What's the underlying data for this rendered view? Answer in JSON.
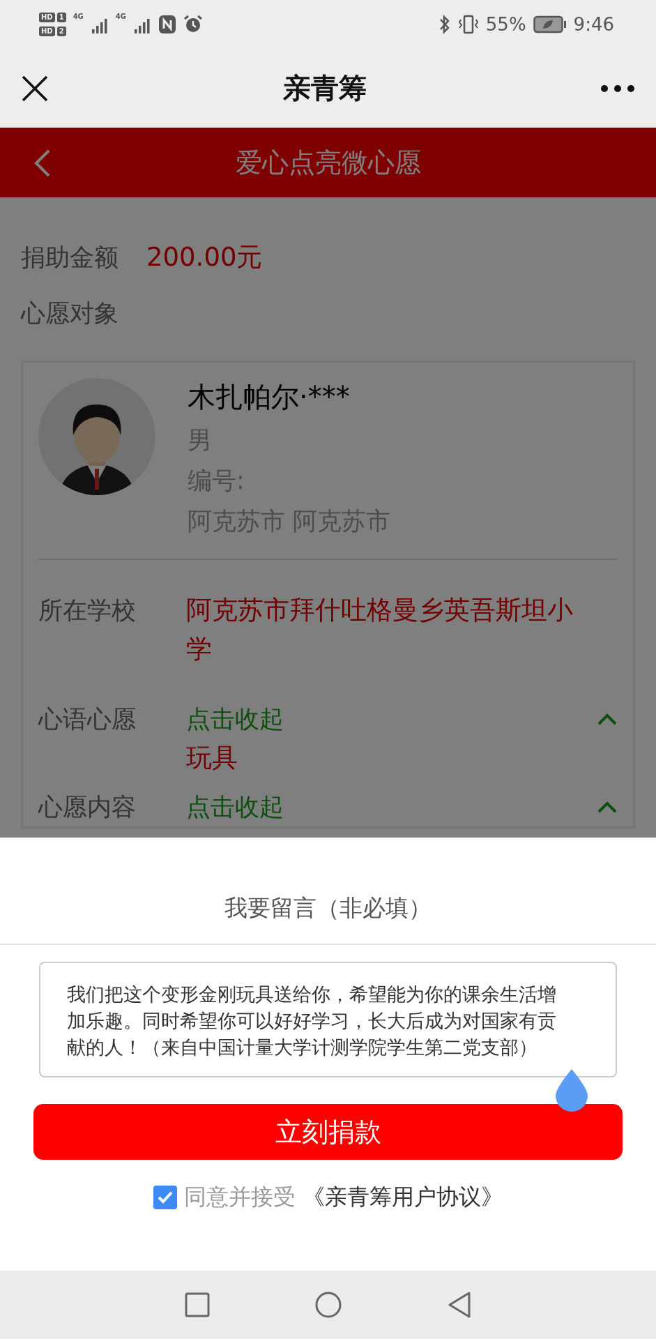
{
  "status_bar": {
    "sims": [
      {
        "label": "HD",
        "slot": "1"
      },
      {
        "label": "HD",
        "slot": "2"
      }
    ],
    "networks": [
      "4G",
      "4G"
    ],
    "battery": "55%",
    "time": "9:46"
  },
  "app_bar": {
    "title": "亲青筹"
  },
  "page_header": {
    "title": "爱心点亮微心愿"
  },
  "amount": {
    "label": "捐助金额",
    "value": "200.00元"
  },
  "section_title": "心愿对象",
  "recipient": {
    "name": "木扎帕尔·***",
    "gender": "男",
    "number_label": "编号:",
    "location": "阿克苏市 阿克苏市"
  },
  "details": [
    {
      "label": "所在学校",
      "kind": "text",
      "value": "阿克苏市拜什吐格曼乡英吾斯坦小学"
    },
    {
      "label": "心语心愿",
      "kind": "toggle",
      "toggle": "点击收起",
      "expanded": true,
      "value": "玩具"
    },
    {
      "label": "心愿内容",
      "kind": "toggle",
      "toggle": "点击收起",
      "expanded": true
    }
  ],
  "message_sheet": {
    "title": "我要留言（非必填）",
    "message": "我们把这个变形金刚玩具送给你，希望能为你的课余生活增加乐趣。同时希望你可以好好学习，长大后成为对国家有贡献的人！（来自中国计量大学计测学院学生第二党支部）",
    "submit": "立刻捐款",
    "agree_checked": true,
    "agree_label": "同意并接受",
    "agreement_link": "《亲青筹用户协议》"
  }
}
